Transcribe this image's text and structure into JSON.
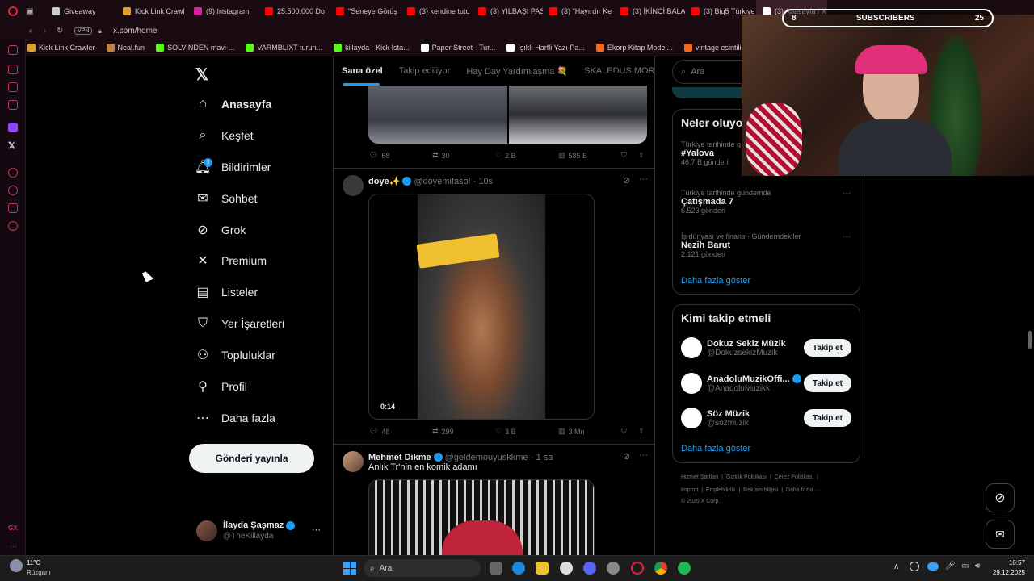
{
  "browser": {
    "tabs": [
      {
        "label": "Giveaway",
        "color": "#cccccc"
      },
      {
        "label": "Kick Link Crawl",
        "color": "#e0a030"
      },
      {
        "label": "(9) Instagram",
        "color": "#d6249f"
      },
      {
        "label": "25.500.000 Do",
        "color": "#ff0000"
      },
      {
        "label": "\"Seneye Görüş",
        "color": "#ff0000"
      },
      {
        "label": "(3) kendine tutu",
        "color": "#ff0000"
      },
      {
        "label": "(3) YILBAŞI PAS",
        "color": "#ff0000"
      },
      {
        "label": "(3) \"Hayırdır Ke",
        "color": "#ff0000"
      },
      {
        "label": "(3) İKİNCİ BALA",
        "color": "#ff0000"
      },
      {
        "label": "(3) Big5 Türkiye",
        "color": "#ff0000"
      },
      {
        "label": "(3) Anasayfa / X",
        "color": "#ffffff"
      }
    ],
    "url": "x.com/home",
    "vpn": "VPN",
    "bookmarks": [
      {
        "label": "Kick Link Crawler",
        "color": "#e0a030"
      },
      {
        "label": "Neal.fun",
        "color": "#c0804a"
      },
      {
        "label": "SOLVINDEN mavi-...",
        "color": "#53fc18"
      },
      {
        "label": "VARMBLIXT turun...",
        "color": "#53fc18"
      },
      {
        "label": "killayda - Kick İsta...",
        "color": "#53fc18"
      },
      {
        "label": "Paper Street - Tur...",
        "color": "#ffffff"
      },
      {
        "label": "Işıklı Harfli Yazı Pa...",
        "color": "#ffffff"
      },
      {
        "label": "Ekorp Kitap Model...",
        "color": "#f26a1b"
      },
      {
        "label": "vintage esintili vini...",
        "color": "#f26a1b"
      }
    ]
  },
  "nav": {
    "items": [
      {
        "label": "Anasayfa",
        "icon": "home-icon",
        "glyph": "⌂"
      },
      {
        "label": "Keşfet",
        "icon": "search-icon",
        "glyph": "⌕"
      },
      {
        "label": "Bildirimler",
        "icon": "bell-icon",
        "glyph": "🔔︎"
      },
      {
        "label": "Sohbet",
        "icon": "mail-icon",
        "glyph": "✉"
      },
      {
        "label": "Grok",
        "icon": "grok-icon",
        "glyph": "⊘"
      },
      {
        "label": "Premium",
        "icon": "x-icon",
        "glyph": "✕"
      },
      {
        "label": "Listeler",
        "icon": "list-icon",
        "glyph": "▤"
      },
      {
        "label": "Yer İşaretleri",
        "icon": "bookmark-icon",
        "glyph": "⛉"
      },
      {
        "label": "Topluluklar",
        "icon": "people-icon",
        "glyph": "⚇"
      },
      {
        "label": "Profil",
        "icon": "person-icon",
        "glyph": "⚲"
      },
      {
        "label": "Daha fazla",
        "icon": "more-circle-icon",
        "glyph": "⋯"
      }
    ],
    "notification_count": "3",
    "post_button": "Gönderi yayınla",
    "account": {
      "name": "İlayda Şaşmaz",
      "handle": "@TheKillayda",
      "more": "···"
    }
  },
  "timeline": {
    "tabs": [
      "Sana özel",
      "Takip ediliyor",
      "Hay Day Yardımlaşma 💐",
      "SKALEDUS MORT"
    ],
    "posts": [
      {
        "stats": {
          "replies": "68",
          "reposts": "30",
          "likes": "2 B",
          "views": "585 B"
        }
      },
      {
        "name": "doye✨",
        "handle": "@doyemifasol",
        "time": "· 10s",
        "video_time": "0:14",
        "stats": {
          "replies": "48",
          "reposts": "299",
          "likes": "3 B",
          "views": "3 Mn"
        }
      },
      {
        "name": "Mehmet Dikme",
        "handle": "@geldemouyuskkme",
        "time": "· 1 sa",
        "text": "Anlık Tr'nin en komik adamı"
      }
    ]
  },
  "right": {
    "search_placeholder": "Ara",
    "trends_title": "Neler oluyo",
    "trends": [
      {
        "context": "Türkiye tarihinde g",
        "name": "#Yalova",
        "count": "46,7 B gönderi"
      },
      {
        "context": "Türkiye tarihinde gündemde",
        "name": "Çatışmada 7",
        "count": "6.523 gönderi"
      },
      {
        "context": "İş dünyası ve finans · Gündemdekiler",
        "name": "Nezih Barut",
        "count": "2.121 gönderi"
      }
    ],
    "trends_more": "Daha fazla göster",
    "follow_title": "Kimi takip etmeli",
    "follow": [
      {
        "name": "Dokuz Sekiz Müzik",
        "handle": "@DokuzsekizMuzik",
        "button": "Takip et",
        "verified": false
      },
      {
        "name": "AnadoluMuzikOffi...",
        "handle": "@AnadoluMuzikk",
        "button": "Takip et",
        "verified": true
      },
      {
        "name": "Söz Müzik",
        "handle": "@sozmuzik",
        "button": "Takip et",
        "verified": false
      }
    ],
    "follow_more": "Daha fazla göster",
    "footer_line1": "Hizmet Şartları  |  Gizlilik Politikası  |  Çerez Politikası  |",
    "footer_line2": "Imprint  |  Erişilebilirlik  |  Reklam bilgisi  |  Daha fazla ···",
    "footer_line3": "© 2025 X Corp."
  },
  "stream_overlay": {
    "left_count": "8",
    "label": "SUBSCRIBERS",
    "right_count": "25"
  },
  "taskbar": {
    "weather_temp": "11°C",
    "weather_desc": "Rüzgarlı",
    "search": "Ara",
    "time": "16:57",
    "date": "29.12.2025"
  },
  "colors": {
    "accent": "#1d9bf0",
    "opera_red": "#c0344f",
    "background": "#000000"
  }
}
